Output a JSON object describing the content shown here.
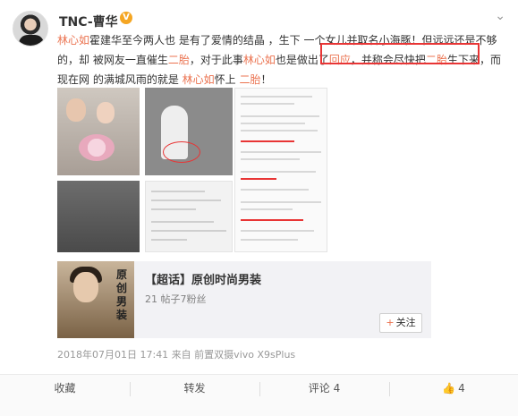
{
  "post": {
    "author": "TNC-曹华",
    "verified_badge": "V",
    "text_segments": [
      {
        "text": "林心如",
        "highlight": true
      },
      {
        "text": "霍建华至今两人也 是有了爱情的结晶 ，生下 一个女儿并取名小海豚！但远远还是不够的，却 被网友一直催生",
        "highlight": false
      },
      {
        "text": "二胎",
        "highlight": true
      },
      {
        "text": "，对于此事",
        "highlight": false
      },
      {
        "text": "林心如",
        "highlight": true
      },
      {
        "text": "也是做出了",
        "highlight": false
      },
      {
        "text": "回应",
        "highlight": true
      },
      {
        "text": "，并称会尽快把",
        "highlight": false
      },
      {
        "text": "二胎",
        "highlight": true
      },
      {
        "text": "生下来，而现在网 的满城风雨的就是 ",
        "highlight": false
      },
      {
        "text": "林心如",
        "highlight": true
      },
      {
        "text": "怀上 ",
        "highlight": false
      },
      {
        "text": "二胎",
        "highlight": true
      },
      {
        "text": "！",
        "highlight": false
      }
    ],
    "timestamp": "2018年07月01日 17:41",
    "source": "来自 前置双摄vivo X9sPlus",
    "topic": {
      "title": "【超话】原创时尚男装",
      "stats": "21 帖子7粉丝",
      "follow_label": "关注",
      "thumb_text": "原创男装"
    },
    "actions": {
      "favorite": "收藏",
      "repost": "转发",
      "comment": "评论 4",
      "like_count": "4"
    }
  },
  "colors": {
    "highlight": "#eb7350",
    "annotation_red": "#e83535",
    "card_bg": "#f2f2f5"
  },
  "icons": {
    "more": "chevron-down-icon",
    "like": "thumbs-up-icon",
    "follow": "plus-icon"
  }
}
